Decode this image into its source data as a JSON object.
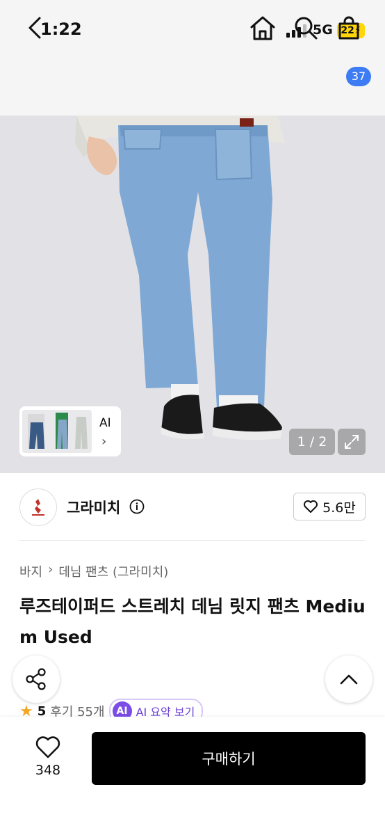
{
  "status_bar": {
    "time": "1:22",
    "network": "5G",
    "battery": "22"
  },
  "nav": {
    "cart_count": "37"
  },
  "gallery": {
    "ai_label": "AI",
    "page_indicator": "1 / 2"
  },
  "brand": {
    "name": "그라미치",
    "likes": "5.6만"
  },
  "product": {
    "breadcrumb": [
      "바지",
      "데님 팬츠 (그라미치)"
    ],
    "title": "루즈테이퍼드 스트레치 데님 릿지 팬츠 Medium Used",
    "rating": "5",
    "reviews": "후기 55개",
    "ai_badge": "AI",
    "ai_summary": "AI 요약 보기"
  },
  "bottom_bar": {
    "wish_count": "348",
    "buy_label": "구매하기"
  },
  "colors": {
    "accent_blue": "#3d7cf2",
    "ai_purple": "#7b4ce6",
    "star": "#f5a623",
    "battery": "#ffd60a"
  }
}
